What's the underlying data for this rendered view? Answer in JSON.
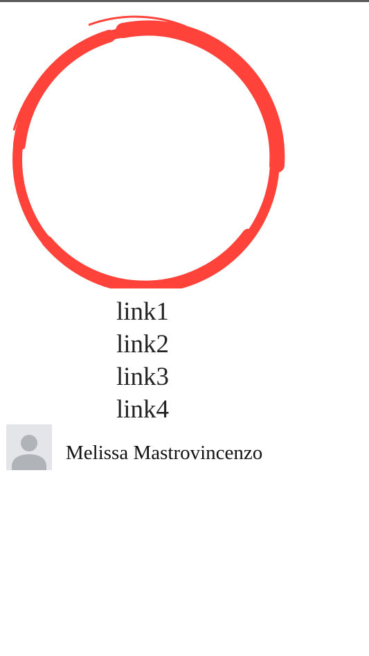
{
  "colors": {
    "accent": "#ff433a",
    "text": "#222222",
    "avatar_bg": "#e3e5e8",
    "avatar_fg": "#b0b4b9"
  },
  "logo": {
    "icon": "brush-circle-icon"
  },
  "nav": {
    "links": [
      {
        "label": "link1"
      },
      {
        "label": "link2"
      },
      {
        "label": "link3"
      },
      {
        "label": "link4"
      }
    ]
  },
  "profile": {
    "avatar_icon": "default-avatar-icon",
    "name": "Melissa Mastrovincenzo"
  }
}
